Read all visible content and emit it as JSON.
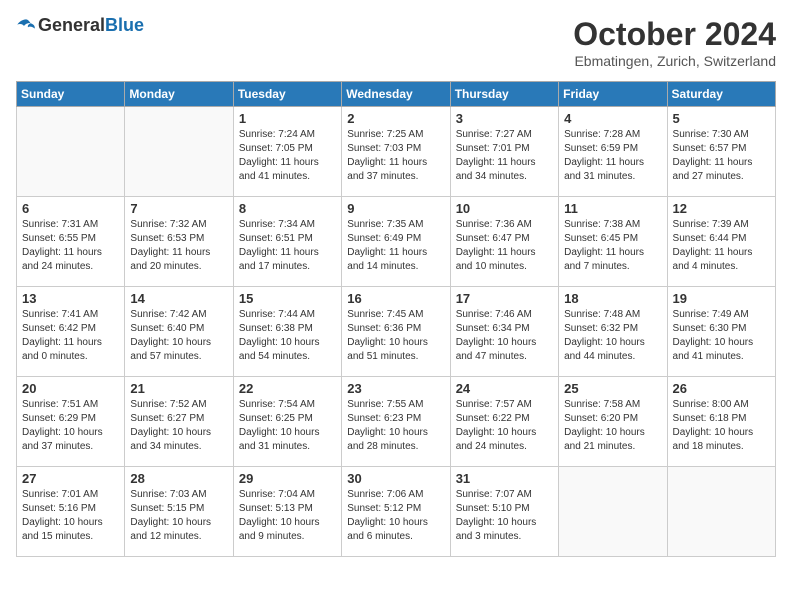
{
  "header": {
    "logo_general": "General",
    "logo_blue": "Blue",
    "month_title": "October 2024",
    "location": "Ebmatingen, Zurich, Switzerland"
  },
  "days_of_week": [
    "Sunday",
    "Monday",
    "Tuesday",
    "Wednesday",
    "Thursday",
    "Friday",
    "Saturday"
  ],
  "weeks": [
    [
      {
        "day": "",
        "info": ""
      },
      {
        "day": "",
        "info": ""
      },
      {
        "day": "1",
        "info": "Sunrise: 7:24 AM\nSunset: 7:05 PM\nDaylight: 11 hours and 41 minutes."
      },
      {
        "day": "2",
        "info": "Sunrise: 7:25 AM\nSunset: 7:03 PM\nDaylight: 11 hours and 37 minutes."
      },
      {
        "day": "3",
        "info": "Sunrise: 7:27 AM\nSunset: 7:01 PM\nDaylight: 11 hours and 34 minutes."
      },
      {
        "day": "4",
        "info": "Sunrise: 7:28 AM\nSunset: 6:59 PM\nDaylight: 11 hours and 31 minutes."
      },
      {
        "day": "5",
        "info": "Sunrise: 7:30 AM\nSunset: 6:57 PM\nDaylight: 11 hours and 27 minutes."
      }
    ],
    [
      {
        "day": "6",
        "info": "Sunrise: 7:31 AM\nSunset: 6:55 PM\nDaylight: 11 hours and 24 minutes."
      },
      {
        "day": "7",
        "info": "Sunrise: 7:32 AM\nSunset: 6:53 PM\nDaylight: 11 hours and 20 minutes."
      },
      {
        "day": "8",
        "info": "Sunrise: 7:34 AM\nSunset: 6:51 PM\nDaylight: 11 hours and 17 minutes."
      },
      {
        "day": "9",
        "info": "Sunrise: 7:35 AM\nSunset: 6:49 PM\nDaylight: 11 hours and 14 minutes."
      },
      {
        "day": "10",
        "info": "Sunrise: 7:36 AM\nSunset: 6:47 PM\nDaylight: 11 hours and 10 minutes."
      },
      {
        "day": "11",
        "info": "Sunrise: 7:38 AM\nSunset: 6:45 PM\nDaylight: 11 hours and 7 minutes."
      },
      {
        "day": "12",
        "info": "Sunrise: 7:39 AM\nSunset: 6:44 PM\nDaylight: 11 hours and 4 minutes."
      }
    ],
    [
      {
        "day": "13",
        "info": "Sunrise: 7:41 AM\nSunset: 6:42 PM\nDaylight: 11 hours and 0 minutes."
      },
      {
        "day": "14",
        "info": "Sunrise: 7:42 AM\nSunset: 6:40 PM\nDaylight: 10 hours and 57 minutes."
      },
      {
        "day": "15",
        "info": "Sunrise: 7:44 AM\nSunset: 6:38 PM\nDaylight: 10 hours and 54 minutes."
      },
      {
        "day": "16",
        "info": "Sunrise: 7:45 AM\nSunset: 6:36 PM\nDaylight: 10 hours and 51 minutes."
      },
      {
        "day": "17",
        "info": "Sunrise: 7:46 AM\nSunset: 6:34 PM\nDaylight: 10 hours and 47 minutes."
      },
      {
        "day": "18",
        "info": "Sunrise: 7:48 AM\nSunset: 6:32 PM\nDaylight: 10 hours and 44 minutes."
      },
      {
        "day": "19",
        "info": "Sunrise: 7:49 AM\nSunset: 6:30 PM\nDaylight: 10 hours and 41 minutes."
      }
    ],
    [
      {
        "day": "20",
        "info": "Sunrise: 7:51 AM\nSunset: 6:29 PM\nDaylight: 10 hours and 37 minutes."
      },
      {
        "day": "21",
        "info": "Sunrise: 7:52 AM\nSunset: 6:27 PM\nDaylight: 10 hours and 34 minutes."
      },
      {
        "day": "22",
        "info": "Sunrise: 7:54 AM\nSunset: 6:25 PM\nDaylight: 10 hours and 31 minutes."
      },
      {
        "day": "23",
        "info": "Sunrise: 7:55 AM\nSunset: 6:23 PM\nDaylight: 10 hours and 28 minutes."
      },
      {
        "day": "24",
        "info": "Sunrise: 7:57 AM\nSunset: 6:22 PM\nDaylight: 10 hours and 24 minutes."
      },
      {
        "day": "25",
        "info": "Sunrise: 7:58 AM\nSunset: 6:20 PM\nDaylight: 10 hours and 21 minutes."
      },
      {
        "day": "26",
        "info": "Sunrise: 8:00 AM\nSunset: 6:18 PM\nDaylight: 10 hours and 18 minutes."
      }
    ],
    [
      {
        "day": "27",
        "info": "Sunrise: 7:01 AM\nSunset: 5:16 PM\nDaylight: 10 hours and 15 minutes."
      },
      {
        "day": "28",
        "info": "Sunrise: 7:03 AM\nSunset: 5:15 PM\nDaylight: 10 hours and 12 minutes."
      },
      {
        "day": "29",
        "info": "Sunrise: 7:04 AM\nSunset: 5:13 PM\nDaylight: 10 hours and 9 minutes."
      },
      {
        "day": "30",
        "info": "Sunrise: 7:06 AM\nSunset: 5:12 PM\nDaylight: 10 hours and 6 minutes."
      },
      {
        "day": "31",
        "info": "Sunrise: 7:07 AM\nSunset: 5:10 PM\nDaylight: 10 hours and 3 minutes."
      },
      {
        "day": "",
        "info": ""
      },
      {
        "day": "",
        "info": ""
      }
    ]
  ]
}
